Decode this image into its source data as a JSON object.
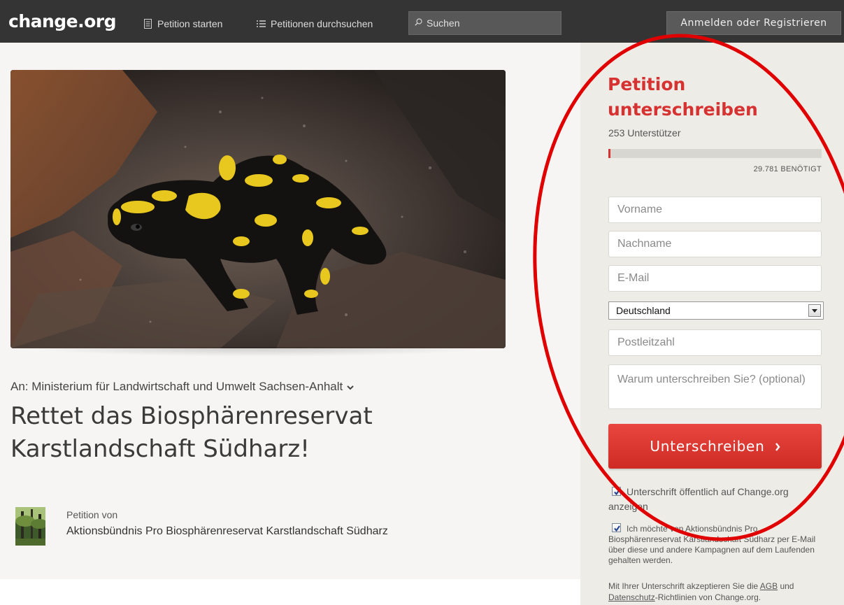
{
  "header": {
    "logo": "change.org",
    "nav_start": "Petition starten",
    "nav_browse": "Petitionen durchsuchen",
    "search_placeholder": "Suchen",
    "login": "Anmelden oder Registrieren"
  },
  "petition": {
    "target": "An: Ministerium für Landwirtschaft und Umwelt Sachsen-Anhalt",
    "title": "Rettet das Biosphärenreservat Karstlandschaft Südharz!",
    "author_label": "Petition von",
    "author_name": "Aktionsbündnis Pro Biosphärenreservat Karstlandschaft Südharz"
  },
  "sidebar": {
    "heading": "Petition unterschreiben",
    "supporters": "253 Unterstützer",
    "progress_fraction": 0.0084,
    "needed": "29.781 BENÖTIGT",
    "firstname_placeholder": "Vorname",
    "lastname_placeholder": "Nachname",
    "email_placeholder": "E-Mail",
    "country": "Deutschland",
    "zip_placeholder": "Postleitzahl",
    "reason_placeholder": "Warum unterschreiben Sie? (optional)",
    "sign_button": "Unterschreiben",
    "checkbox_public": "Unterschrift öffentlich auf Change.org anzeigen",
    "checkbox_updates": "Ich möchte von Aktionsbündnis Pro Biosphärenreservat Karstlandschaft Südharz per E-Mail über diese und andere Kampagnen auf dem Laufenden gehalten werden.",
    "terms_prefix": "Mit Ihrer Unterschrift akzeptieren Sie die",
    "terms_agb": "AGB",
    "terms_and": "und",
    "terms_privacy": "Datenschutz",
    "terms_suffix": "-Richtlinien von Change.org."
  },
  "colors": {
    "accent": "#d73232",
    "topbar": "#343434",
    "sidebar_bg": "#eeece6",
    "annotation": "#e00000"
  }
}
